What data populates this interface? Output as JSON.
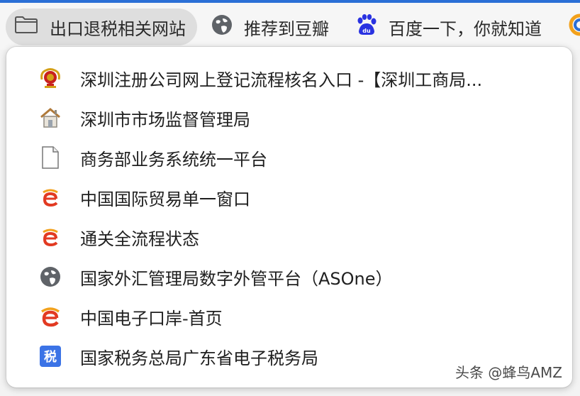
{
  "bookmarks_bar": {
    "items": [
      {
        "label": "出口退税相关网站",
        "icon": "folder-icon"
      },
      {
        "label": "推荐到豆瓣",
        "icon": "globe-icon"
      },
      {
        "label": "百度一下，你就知道",
        "icon": "baidu-paw-icon"
      },
      {
        "label": "",
        "icon": "partial-favicon"
      }
    ]
  },
  "dropdown": {
    "items": [
      {
        "label": "深圳注册公司网上登记流程核名入口 -【深圳工商局...",
        "icon": "police-emblem-icon"
      },
      {
        "label": "深圳市市场监督管理局",
        "icon": "house-icon"
      },
      {
        "label": "商务部业务系统统一平台",
        "icon": "document-icon"
      },
      {
        "label": "中国国际贸易单一窗口",
        "icon": "e-port-icon"
      },
      {
        "label": "通关全流程状态",
        "icon": "e-port-icon"
      },
      {
        "label": "国家外汇管理局数字外管平台（ASOne）",
        "icon": "globe-icon"
      },
      {
        "label": "中国电子口岸-首页",
        "icon": "e-port-icon"
      },
      {
        "label": "国家税务总局广东省电子税务局",
        "icon": "tax-icon"
      }
    ]
  },
  "watermark": {
    "text": "头条 @蜂鸟AMZ"
  },
  "colors": {
    "accent_top": "#2b6fd6",
    "folder_bg": "#dedede",
    "baidu_blue": "#2932e1",
    "tax_blue": "#3b73e6",
    "eport_red": "#e23a22",
    "eport_orange": "#f2a11c"
  }
}
